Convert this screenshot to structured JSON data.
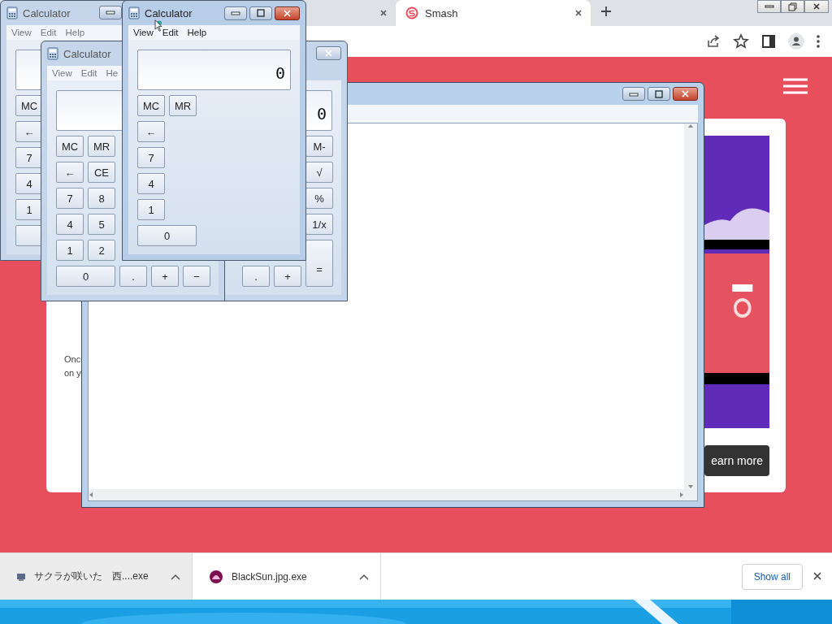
{
  "browser": {
    "tabs": [
      {
        "selected": false
      },
      {
        "title": "Smash",
        "selected": true
      }
    ]
  },
  "page": {
    "text_lines": [
      "Onc",
      "on y"
    ],
    "button": "earn more"
  },
  "downloads": {
    "items": [
      {
        "name": "サクラが咲いた　西....exe",
        "hovered": true
      },
      {
        "name": "BlackSun.jpg.exe",
        "hovered": false
      }
    ],
    "show_all": "Show all"
  },
  "calculators": [
    {
      "title": "Calculator",
      "active": false,
      "menu": [
        "View",
        "Edit",
        "Help"
      ],
      "rows": [
        [
          {
            "label": "MC",
            "kind": "normal"
          }
        ],
        [
          {
            "label": "←",
            "kind": "normal"
          }
        ],
        [
          {
            "label": "7",
            "kind": "normal"
          }
        ],
        [
          {
            "label": "4",
            "kind": "normal"
          }
        ],
        [
          {
            "label": "1",
            "kind": "normal"
          }
        ],
        [
          {
            "kind": "normal"
          }
        ]
      ]
    },
    {
      "title": "Calculator",
      "active": true,
      "menu": [
        "View",
        "Edit",
        "Help"
      ],
      "display": "0",
      "rows": [
        [
          {
            "label": "MC",
            "kind": "normal"
          },
          {
            "label": "MR",
            "kind": "normal"
          }
        ],
        [
          {
            "label": "←",
            "kind": "normal"
          }
        ],
        [
          {
            "label": "7",
            "kind": "normal"
          }
        ],
        [
          {
            "label": "4",
            "kind": "normal"
          }
        ],
        [
          {
            "label": "1",
            "kind": "normal"
          }
        ],
        [
          {
            "label": "0",
            "kind": "wide"
          }
        ]
      ]
    },
    {
      "title": "Calculator",
      "active": false,
      "menu": [
        "View",
        "Edit",
        "He"
      ],
      "rows": [
        [
          {
            "label": "MC",
            "kind": "normal"
          },
          {
            "label": "MR",
            "kind": "normal"
          }
        ],
        [
          {
            "label": "←",
            "kind": "normal"
          },
          {
            "label": "CE",
            "kind": "normal"
          }
        ],
        [
          {
            "label": "7",
            "kind": "normal"
          },
          {
            "label": "8",
            "kind": "normal"
          }
        ],
        [
          {
            "label": "4",
            "kind": "normal"
          },
          {
            "label": "5",
            "kind": "normal"
          }
        ],
        [
          {
            "label": "1",
            "kind": "normal"
          },
          {
            "label": "2",
            "kind": "normal"
          }
        ],
        [
          {
            "label": "0",
            "kind": "wide"
          },
          {
            "label": ".",
            "kind": "normal"
          },
          {
            "label": "+",
            "kind": "normal"
          },
          {
            "label": "−",
            "kind": "normal"
          }
        ]
      ]
    },
    {
      "active": false,
      "display": "0",
      "rows": [
        [
          {
            "kind": "blank"
          },
          {
            "kind": "blank"
          },
          {
            "kind": "blank"
          },
          {
            "kind": "blank"
          },
          {
            "label": "M-",
            "kind": "normal"
          }
        ],
        [
          {
            "kind": "blank"
          },
          {
            "kind": "blank"
          },
          {
            "kind": "blank"
          },
          {
            "kind": "blank"
          },
          {
            "label": "√",
            "kind": "normal"
          }
        ],
        [
          {
            "kind": "blank"
          },
          {
            "kind": "blank"
          },
          {
            "kind": "blank"
          },
          {
            "kind": "blank"
          },
          {
            "label": "%",
            "kind": "normal"
          }
        ],
        [
          {
            "kind": "blank"
          },
          {
            "kind": "blank"
          },
          {
            "kind": "blank"
          },
          {
            "kind": "blank"
          },
          {
            "label": "1/x",
            "kind": "normal"
          }
        ],
        [
          {
            "kind": "blank"
          },
          {
            "kind": "blank"
          },
          {
            "kind": "blank"
          },
          {
            "kind": "blank"
          },
          {
            "label": "=",
            "kind": "tall"
          }
        ],
        [
          {
            "kind": "blank"
          },
          {
            "kind": "blank"
          },
          {
            "label": ".",
            "kind": "normal"
          },
          {
            "label": "+",
            "kind": "normal"
          }
        ]
      ]
    }
  ]
}
